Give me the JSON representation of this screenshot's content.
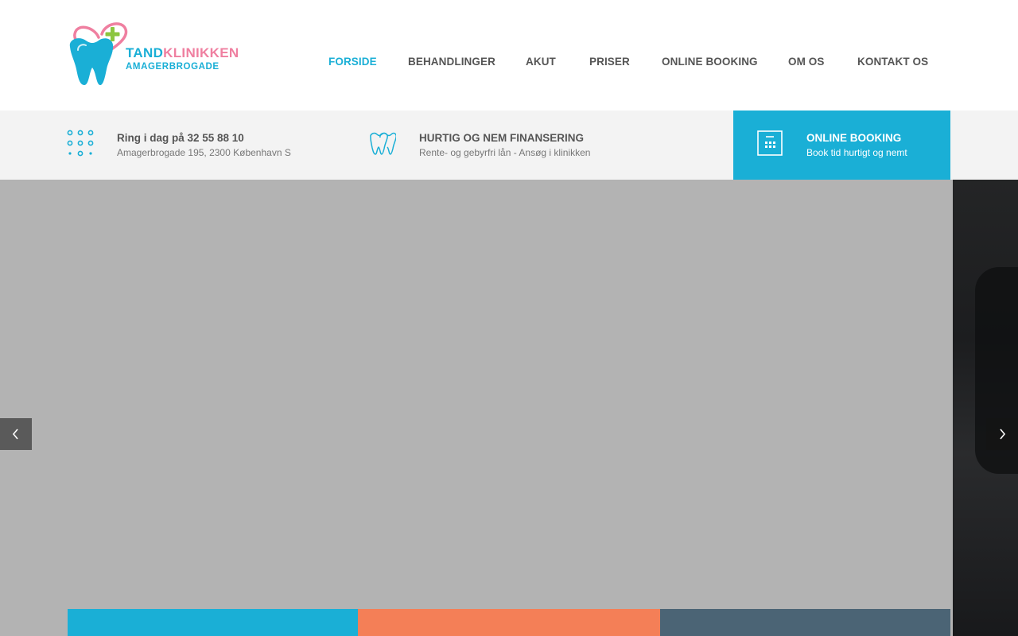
{
  "logo": {
    "word1": "TAND",
    "word2": "KLINIKKEN",
    "line2": "AMAGERBROGADE",
    "colors": {
      "blue": "#1aafd6",
      "pink": "#ef7fa0",
      "green": "#8cc63f"
    }
  },
  "nav": {
    "items": [
      {
        "label": "FORSIDE",
        "active": true
      },
      {
        "label": "BEHANDLINGER",
        "active": false
      },
      {
        "label": "AKUT",
        "active": false
      },
      {
        "label": "PRISER",
        "active": false
      },
      {
        "label": "ONLINE BOOKING",
        "active": false
      },
      {
        "label": "OM OS",
        "active": false
      },
      {
        "label": "KONTAKT OS",
        "active": false
      }
    ]
  },
  "infobar": {
    "phone": {
      "icon": "dial-pad-icon",
      "title": "Ring i dag på 32 55 88 10",
      "subtitle": "Amagerbrogade 195, 2300 København S"
    },
    "finance": {
      "icon": "teeth-icon",
      "title": "HURTIG OG NEM FINANSERING",
      "subtitle": "Rente- og gebyrfri lån - Ansøg i klinikken"
    },
    "booking": {
      "icon": "calendar-icon",
      "title": "ONLINE BOOKING",
      "subtitle": "Book tid hurtigt og nemt"
    }
  },
  "slider": {
    "prev_icon": "chevron-left-icon",
    "next_icon": "chevron-right-icon",
    "feature_colors": [
      "#1aafd6",
      "#f47f57",
      "#4b6475"
    ]
  },
  "theme": {
    "accent": "#1aafd6",
    "infobar_bg": "#f3f3f3",
    "slide_bg": "#b3b3b3"
  }
}
